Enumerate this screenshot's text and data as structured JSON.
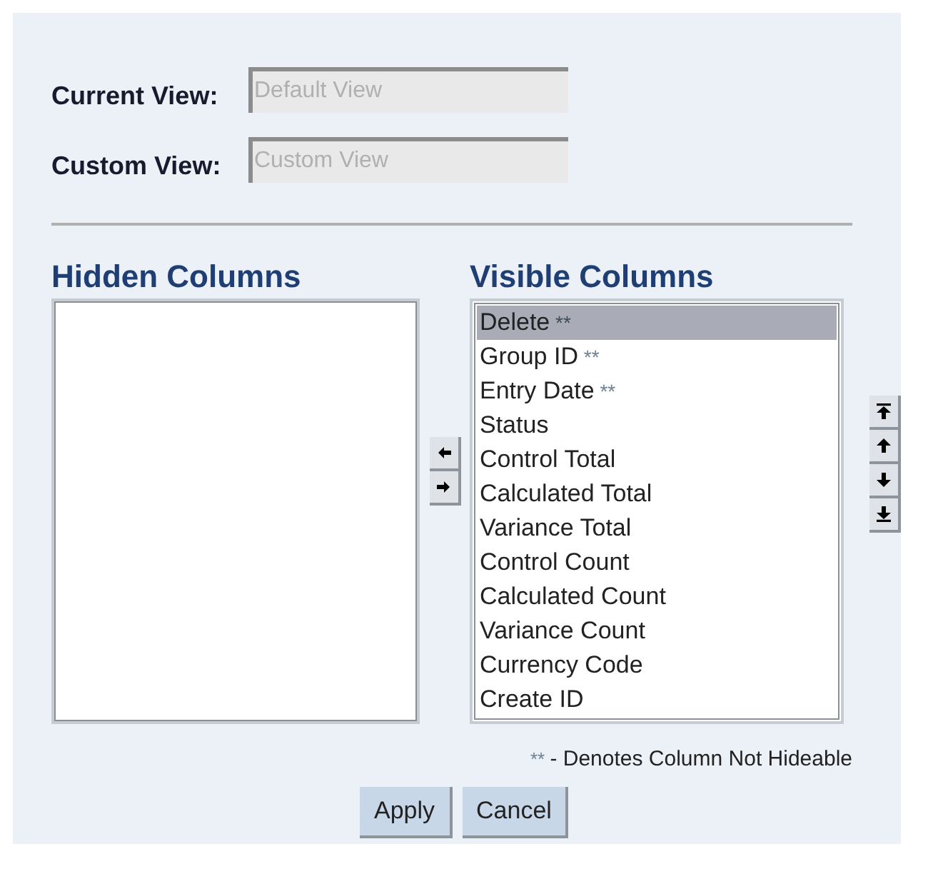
{
  "view_fields": [
    {
      "label": "Current View:",
      "placeholder": "Default View"
    },
    {
      "label": "Custom View:",
      "placeholder": "Custom View"
    }
  ],
  "hidden_columns": {
    "title": "Hidden Columns"
  },
  "transfer_buttons": [
    {
      "kind": "left"
    },
    {
      "kind": "right"
    }
  ],
  "visible_columns": {
    "title": "Visible Columns",
    "items": [
      {
        "label": "Delete",
        "marker": "**",
        "selected": true
      },
      {
        "label": "Group ID",
        "marker": "**",
        "selected": false
      },
      {
        "label": "Entry Date",
        "marker": "**",
        "selected": false
      },
      {
        "label": "Status",
        "selected": false
      },
      {
        "label": "Control Total",
        "selected": false
      },
      {
        "label": "Calculated Total",
        "selected": false
      },
      {
        "label": "Variance Total",
        "selected": false
      },
      {
        "label": "Control Count",
        "selected": false
      },
      {
        "label": "Calculated Count",
        "selected": false
      },
      {
        "label": "Variance Count",
        "selected": false
      },
      {
        "label": "Currency Code",
        "selected": false
      },
      {
        "label": "Create ID",
        "selected": false
      }
    ]
  },
  "order_buttons": [
    {
      "kind": "top"
    },
    {
      "kind": "up"
    },
    {
      "kind": "down"
    },
    {
      "kind": "bottom"
    }
  ],
  "note": {
    "marker": "**",
    "text": "- Denotes Column Not Hideable"
  },
  "buttons": [
    "Apply",
    "Cancel"
  ]
}
